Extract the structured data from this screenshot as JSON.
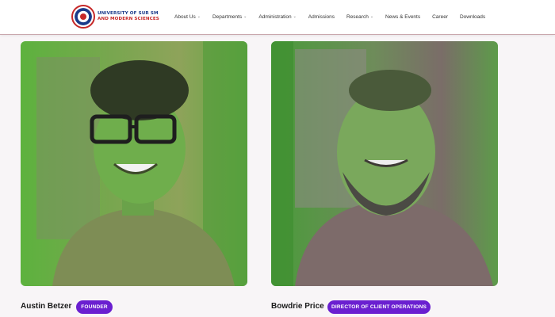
{
  "header": {
    "logo": {
      "line1": "UNIVERSITY OF SUR SM",
      "line2": "AND MODERN SCIENCES"
    },
    "nav": [
      {
        "label": "About Us",
        "has_dropdown": true
      },
      {
        "label": "Departments",
        "has_dropdown": true
      },
      {
        "label": "Administration",
        "has_dropdown": true
      },
      {
        "label": "Admissions",
        "has_dropdown": false
      },
      {
        "label": "Research",
        "has_dropdown": true
      },
      {
        "label": "News & Events",
        "has_dropdown": false
      },
      {
        "label": "Career",
        "has_dropdown": false
      },
      {
        "label": "Downloads",
        "has_dropdown": false
      }
    ],
    "dropdown_icon": "chevron-down-icon"
  },
  "team": [
    {
      "name": "Austin Betzer",
      "role": "FOUNDER"
    },
    {
      "name": "Bowdrie Price",
      "role": "DIRECTOR OF CLIENT OPERATIONS"
    }
  ],
  "colors": {
    "accent_purple": "#6a1fd0",
    "brand_blue": "#1a3a8a",
    "brand_red": "#c62828",
    "page_background": "#f8f5f7"
  }
}
